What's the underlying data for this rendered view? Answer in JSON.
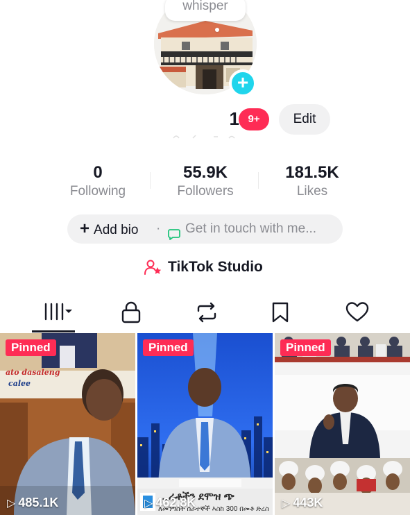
{
  "profile": {
    "note": "whisper",
    "username": "1",
    "notification_badge": "9+",
    "edit_label": "Edit"
  },
  "stats": [
    {
      "value": "0",
      "label": "Following"
    },
    {
      "value": "55.9K",
      "label": "Followers"
    },
    {
      "value": "181.5K",
      "label": "Likes"
    }
  ],
  "bio": {
    "add_bio_label": "Add bio",
    "separator": "·",
    "contact_label": "Get in touch with me..."
  },
  "studio": {
    "label": "TikTok Studio"
  },
  "tabs": [
    {
      "name": "videos",
      "icon": "grid-icon",
      "active": true
    },
    {
      "name": "private",
      "icon": "lock-icon"
    },
    {
      "name": "reposts",
      "icon": "repost-icon"
    },
    {
      "name": "favorites",
      "icon": "bookmark-icon"
    },
    {
      "name": "liked",
      "icon": "heart-icon"
    }
  ],
  "videos": [
    {
      "pinned_label": "Pinned",
      "views": "485.1K",
      "overlay_text_1": "ato dasaleng",
      "overlay_text_2": "calee"
    },
    {
      "pinned_label": "Pinned",
      "views": "462.8K",
      "caption": "…ራቶችን ደሞዝ ጭ",
      "caption_sub": "ለመንግስት ሰራተኞች እስከ 300 በመቶ ድረስ"
    },
    {
      "pinned_label": "Pinned",
      "views": "443K"
    }
  ],
  "colors": {
    "accent_red": "#fe2c55",
    "accent_cyan": "#20d5ec",
    "text_primary": "#161823",
    "text_secondary": "#8a8b91",
    "pill_bg": "#f1f1f2"
  }
}
